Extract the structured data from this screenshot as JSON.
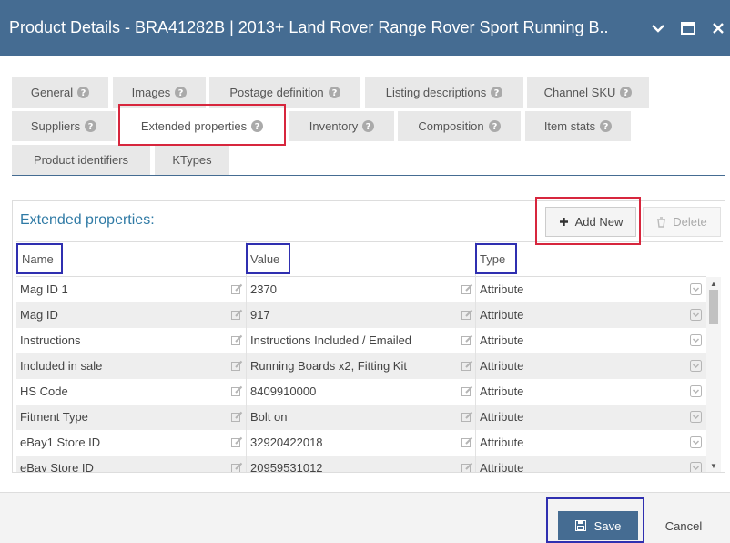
{
  "window": {
    "title": "Product Details - BRA41282B | 2013+ Land Rover Range Rover Sport Running B..."
  },
  "tabs": [
    {
      "label": "General",
      "has_help": true
    },
    {
      "label": "Images",
      "has_help": true
    },
    {
      "label": "Postage definition",
      "has_help": true
    },
    {
      "label": "Listing descriptions",
      "has_help": true
    },
    {
      "label": "Channel SKU",
      "has_help": true
    },
    {
      "label": "Suppliers",
      "has_help": true
    },
    {
      "label": "Extended properties",
      "has_help": true,
      "active": true
    },
    {
      "label": "Inventory",
      "has_help": true
    },
    {
      "label": "Composition",
      "has_help": true
    },
    {
      "label": "Item stats",
      "has_help": true
    },
    {
      "label": "Product identifiers",
      "has_help": false
    },
    {
      "label": "KTypes",
      "has_help": false
    }
  ],
  "panel": {
    "title": "Extended properties:",
    "add_label": "Add New",
    "delete_label": "Delete"
  },
  "grid": {
    "headers": {
      "name": "Name",
      "value": "Value",
      "type": "Type"
    },
    "rows": [
      {
        "name": "Mag ID 1",
        "value": "2370",
        "type": "Attribute"
      },
      {
        "name": "Mag ID",
        "value": "917",
        "type": "Attribute"
      },
      {
        "name": "Instructions",
        "value": "Instructions Included / Emailed",
        "type": "Attribute"
      },
      {
        "name": "Included in sale",
        "value": "Running Boards x2, Fitting Kit",
        "type": "Attribute"
      },
      {
        "name": "HS Code",
        "value": "8409910000",
        "type": "Attribute"
      },
      {
        "name": "Fitment Type",
        "value": "Bolt on",
        "type": "Attribute"
      },
      {
        "name": "eBay1 Store ID",
        "value": "32920422018",
        "type": "Attribute"
      },
      {
        "name": "eBay Store ID",
        "value": "20959531012",
        "type": "Attribute"
      }
    ]
  },
  "footer": {
    "save_label": "Save",
    "cancel_label": "Cancel"
  },
  "colors": {
    "titlebar": "#456c92",
    "accent_text": "#2f7aa5",
    "highlight_red": "#d7263d",
    "highlight_blue": "#2f2fb0"
  }
}
